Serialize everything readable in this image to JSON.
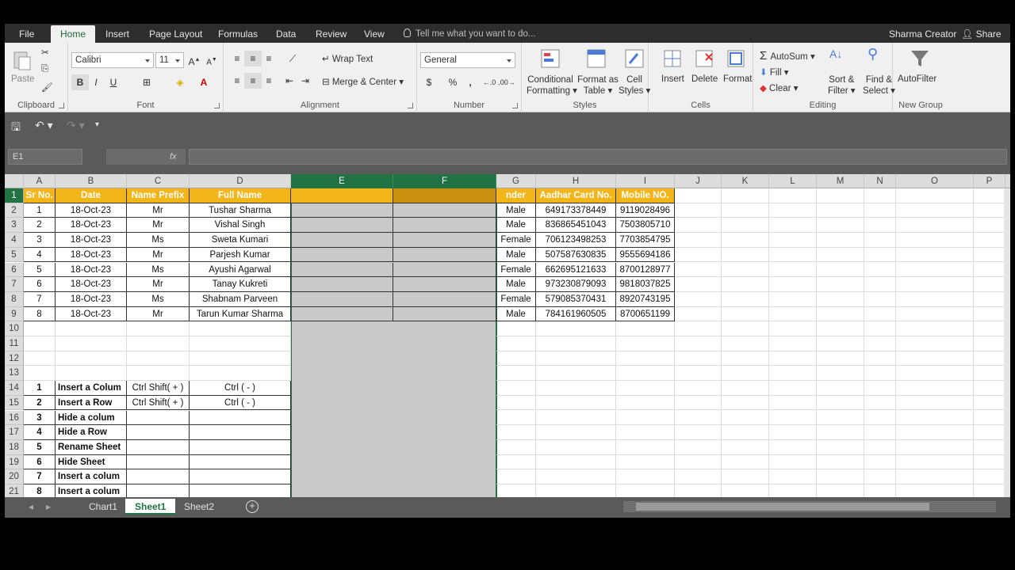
{
  "ribbon_tabs": [
    "File",
    "Home",
    "Insert",
    "Page Layout",
    "Formulas",
    "Data",
    "Review",
    "View"
  ],
  "active_tab": "Home",
  "tell_me": "Tell me what you want to do...",
  "user": "Sharma Creator",
  "share": "Share",
  "clipboard": {
    "paste": "Paste",
    "label": "Clipboard"
  },
  "font": {
    "name": "Calibri",
    "size": "11",
    "bold": "B",
    "italic": "I",
    "underline": "U",
    "label": "Font"
  },
  "alignment": {
    "wrap": "Wrap Text",
    "merge": "Merge & Center",
    "label": "Alignment"
  },
  "number": {
    "format": "General",
    "currency": "$",
    "percent": "%",
    "comma": ",",
    "label": "Number"
  },
  "styles": {
    "cond": "Conditional",
    "cond2": "Formatting",
    "fmt_table": "Format as",
    "fmt_table2": "Table",
    "cell_styles": "Cell",
    "cell_styles2": "Styles",
    "label": "Styles"
  },
  "cells": {
    "insert": "Insert",
    "delete": "Delete",
    "format": "Format",
    "label": "Cells"
  },
  "editing": {
    "autosum": "AutoSum",
    "fill": "Fill",
    "clear": "Clear",
    "sort": "Sort &",
    "sort2": "Filter",
    "find": "Find &",
    "find2": "Select",
    "label": "Editing"
  },
  "newgroup": {
    "autofilter": "AutoFilter",
    "label": "New Group"
  },
  "namebox": "E1",
  "fx": "fx",
  "columns": [
    "A",
    "B",
    "C",
    "D",
    "E",
    "F",
    "G",
    "H",
    "I",
    "J",
    "K",
    "L",
    "M",
    "N",
    "O",
    "P"
  ],
  "header_row": [
    "Sr No.",
    "Date",
    "Name Prefix",
    "Full Name",
    "",
    "",
    "nder",
    "Aadhar Card No.",
    "Mobile NO."
  ],
  "data_rows": [
    [
      "1",
      "18-Oct-23",
      "Mr",
      "Tushar Sharma",
      "Male",
      "649173378449",
      "9119028496"
    ],
    [
      "2",
      "18-Oct-23",
      "Mr",
      "Vishal Singh",
      "Male",
      "836865451043",
      "7503805710"
    ],
    [
      "3",
      "18-Oct-23",
      "Ms",
      "Sweta Kumari",
      "Female",
      "706123498253",
      "7703854795"
    ],
    [
      "4",
      "18-Oct-23",
      "Mr",
      "Parjesh Kumar",
      "Male",
      "507587630835",
      "9555694186"
    ],
    [
      "5",
      "18-Oct-23",
      "Ms",
      "Ayushi Agarwal",
      "Female",
      "662695121633",
      "8700128977"
    ],
    [
      "6",
      "18-Oct-23",
      "Mr",
      "Tanay Kukreti",
      "Male",
      "973230879093",
      "9818037825"
    ],
    [
      "7",
      "18-Oct-23",
      "Ms",
      "Shabnam Parveen",
      "Female",
      "579085370431",
      "8920743195"
    ],
    [
      "8",
      "18-Oct-23",
      "Mr",
      "Tarun Kumar Sharma",
      "Male",
      "784161960505",
      "8700651199"
    ]
  ],
  "shortcut_rows": [
    [
      "1",
      "Insert a Colum",
      "Ctrl Shift( + )",
      "Ctrl ( - )"
    ],
    [
      "2",
      "Insert a Row",
      "Ctrl Shift( + )",
      "Ctrl ( - )"
    ],
    [
      "3",
      "Hide a colum",
      "",
      ""
    ],
    [
      "4",
      "Hide a Row",
      "",
      ""
    ],
    [
      "5",
      "Rename Sheet",
      "",
      ""
    ],
    [
      "6",
      "Hide Sheet",
      "",
      ""
    ],
    [
      "7",
      "Insert a colum",
      "",
      ""
    ],
    [
      "8",
      "Insert a colum",
      "",
      ""
    ]
  ],
  "row_numbers": [
    "1",
    "2",
    "3",
    "4",
    "5",
    "6",
    "7",
    "8",
    "9",
    "10",
    "11",
    "12",
    "13",
    "14",
    "15",
    "16",
    "17",
    "18",
    "19",
    "20",
    "21"
  ],
  "sheets": [
    "Chart1",
    "Sheet1",
    "Sheet2"
  ],
  "active_sheet": "Sheet1",
  "colors": {
    "header_fill": "#f2b51a",
    "accent": "#217346"
  }
}
